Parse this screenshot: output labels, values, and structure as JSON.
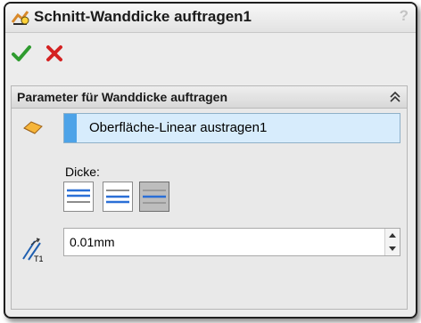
{
  "window": {
    "title": "Schnitt-Wanddicke auftragen1",
    "help_glyph": "?"
  },
  "toolbar": {
    "ok_icon": "green-check-icon",
    "cancel_icon": "red-x-icon"
  },
  "group": {
    "title": "Parameter für Wanddicke auftragen",
    "selection_value": "Oberfläche-Linear austragen1",
    "thickness_label": "Dicke:",
    "thickness_value": "0.01mm",
    "direction_buttons": [
      "direction-side-1",
      "direction-side-2",
      "direction-both-sides"
    ]
  },
  "colors": {
    "selection_bg": "#d7ecfc",
    "selection_marker": "#4da3e8",
    "accent_blue": "#2a6fd6"
  }
}
